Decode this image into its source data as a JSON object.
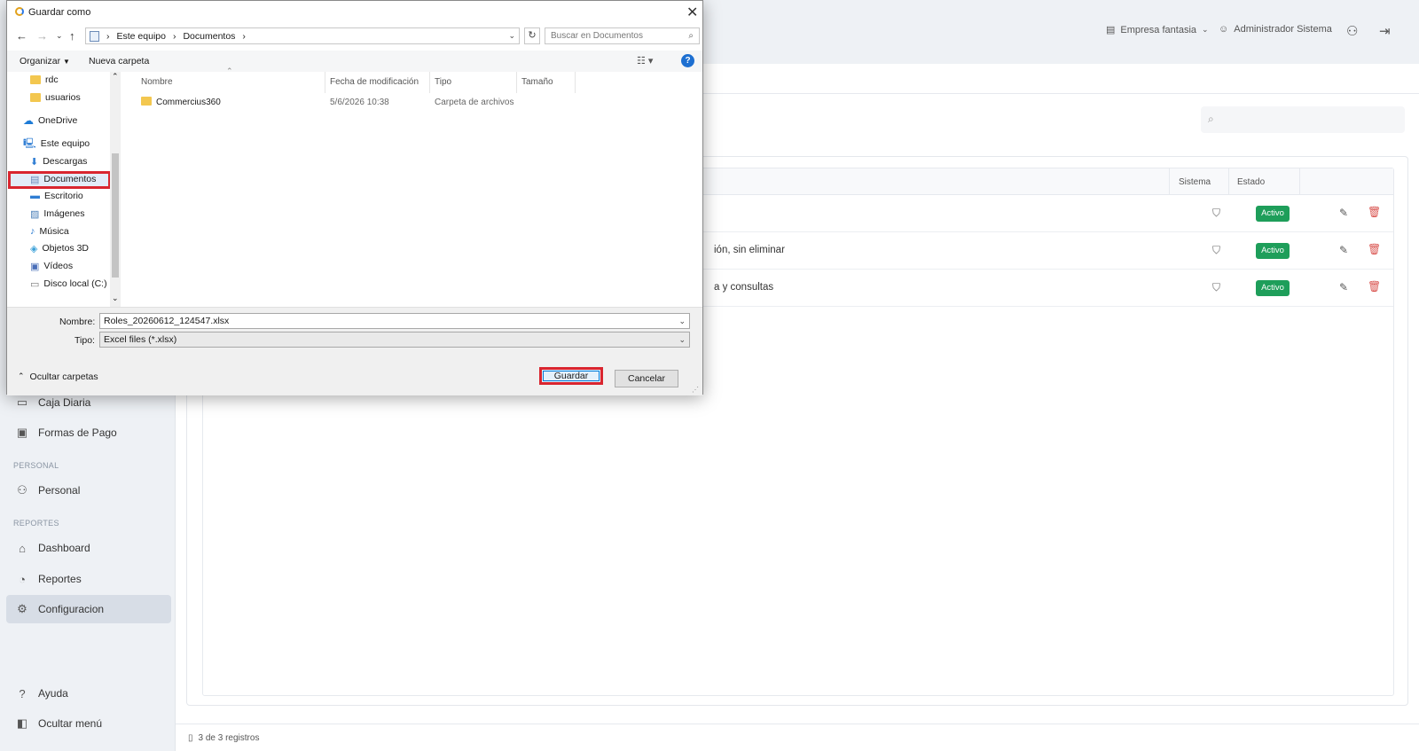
{
  "app": {
    "company": "Empresa fantasia",
    "user": "Administrador Sistema",
    "sidebar": {
      "items": [
        {
          "label": "Caja Diaria",
          "icon": "cash-register-icon"
        },
        {
          "label": "Formas de Pago",
          "icon": "payment-card-icon"
        },
        {
          "label": "Personal",
          "icon": "users-icon"
        },
        {
          "label": "Dashboard",
          "icon": "home-icon"
        },
        {
          "label": "Reportes",
          "icon": "report-icon"
        },
        {
          "label": "Configuracion",
          "icon": "gear-icon"
        },
        {
          "label": "Ayuda",
          "icon": "help-icon"
        },
        {
          "label": "Ocultar menú",
          "icon": "collapse-menu-icon"
        }
      ],
      "sections": {
        "personal": "PERSONAL",
        "reportes": "REPORTES"
      }
    },
    "table": {
      "columns": {
        "sistema": "Sistema",
        "estado": "Estado"
      },
      "rows": [
        {
          "description": "",
          "status": "Activo"
        },
        {
          "description": "ión, sin eliminar",
          "status": "Activo"
        },
        {
          "description": "a y consultas",
          "status": "Activo"
        }
      ]
    },
    "footer": {
      "records": "3 de 3 registros"
    }
  },
  "dialog": {
    "title": "Guardar como",
    "breadcrumb": [
      "Este equipo",
      "Documentos"
    ],
    "search_placeholder": "Buscar en Documentos",
    "commands": {
      "organize": "Organizar",
      "new_folder": "Nueva carpeta"
    },
    "nav": [
      {
        "label": "rdc",
        "icon": "folder-icon"
      },
      {
        "label": "usuarios",
        "icon": "folder-icon"
      },
      {
        "label": "OneDrive",
        "icon": "onedrive-icon"
      },
      {
        "label": "Este equipo",
        "icon": "computer-icon"
      },
      {
        "label": "Descargas",
        "icon": "download-icon"
      },
      {
        "label": "Documentos",
        "icon": "documents-icon"
      },
      {
        "label": "Escritorio",
        "icon": "desktop-icon"
      },
      {
        "label": "Imágenes",
        "icon": "pictures-icon"
      },
      {
        "label": "Música",
        "icon": "music-icon"
      },
      {
        "label": "Objetos 3D",
        "icon": "cube-icon"
      },
      {
        "label": "Vídeos",
        "icon": "video-icon"
      },
      {
        "label": "Disco local (C:)",
        "icon": "drive-icon"
      }
    ],
    "file_columns": {
      "name": "Nombre",
      "modified": "Fecha de modificación",
      "type": "Tipo",
      "size": "Tamaño"
    },
    "files": [
      {
        "name": "Commercius360",
        "modified": "5/6/2026 10:38",
        "type": "Carpeta de archivos",
        "size": ""
      }
    ],
    "filename_label": "Nombre:",
    "filename": "Roles_20260612_124547.xlsx",
    "type_label": "Tipo:",
    "filetype": "Excel files (*.xlsx)",
    "hide_folders": "Ocultar carpetas",
    "save": "Guardar",
    "cancel": "Cancelar"
  }
}
